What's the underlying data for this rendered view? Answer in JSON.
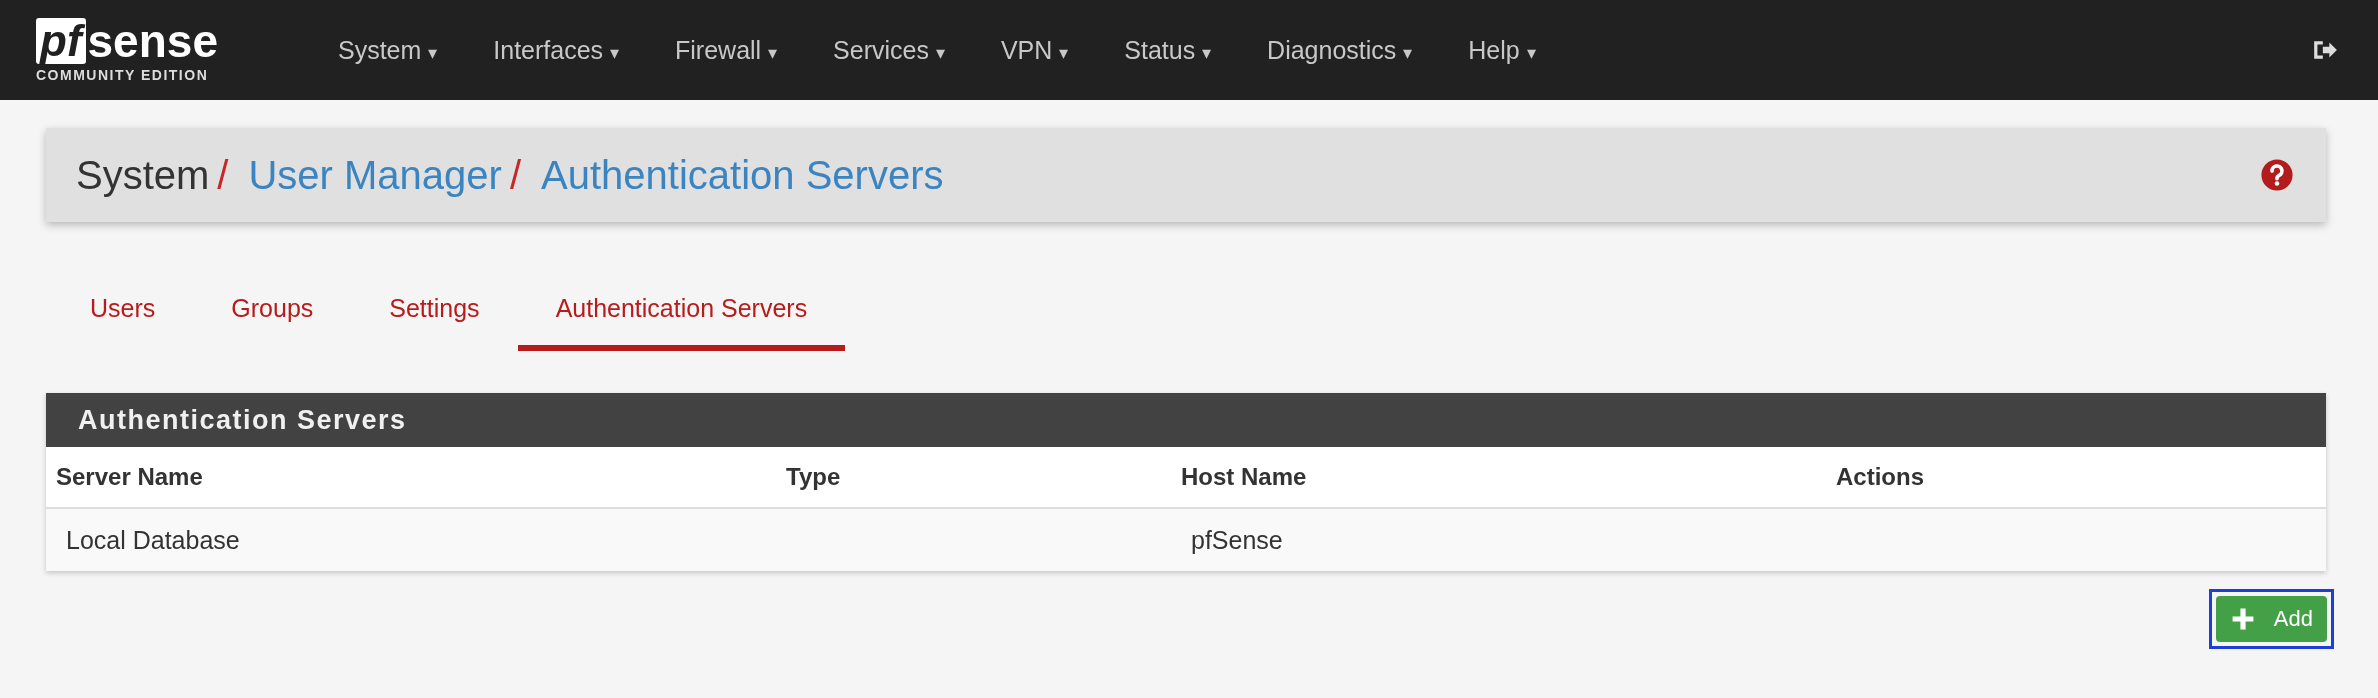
{
  "logo": {
    "mark": "pf",
    "word": "sense",
    "edition": "COMMUNITY EDITION"
  },
  "nav": [
    {
      "label": "System",
      "caret": "▾"
    },
    {
      "label": "Interfaces",
      "caret": "▾"
    },
    {
      "label": "Firewall",
      "caret": "▾"
    },
    {
      "label": "Services",
      "caret": "▾"
    },
    {
      "label": "VPN",
      "caret": "▾"
    },
    {
      "label": "Status",
      "caret": "▾"
    },
    {
      "label": "Diagnostics",
      "caret": "▾"
    },
    {
      "label": "Help",
      "caret": "▾"
    }
  ],
  "breadcrumb": [
    {
      "label": "System",
      "link": false,
      "separator": "/"
    },
    {
      "label": "User Manager",
      "link": true,
      "separator": "/"
    },
    {
      "label": "Authentication Servers",
      "link": true
    }
  ],
  "tabs": [
    {
      "label": "Users",
      "selected": false
    },
    {
      "label": "Groups",
      "selected": false
    },
    {
      "label": "Settings",
      "selected": false
    },
    {
      "label": "Authentication Servers",
      "selected": true
    }
  ],
  "panel": {
    "title": "Authentication Servers",
    "columns": [
      "Server Name",
      "Type",
      "Host Name",
      "Actions"
    ],
    "rows": [
      [
        "Local Database",
        "",
        "pfSense",
        ""
      ]
    ]
  },
  "add_button": {
    "label": "Add",
    "highlighted": true
  }
}
